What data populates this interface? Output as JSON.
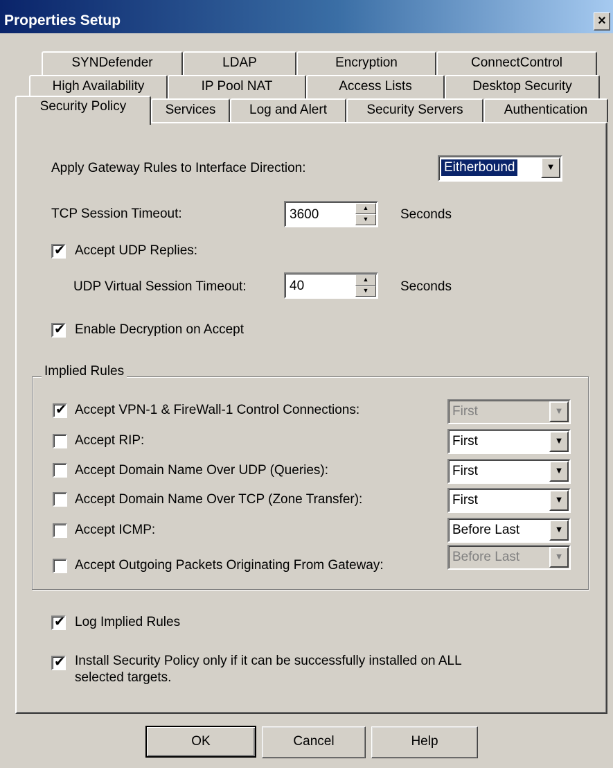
{
  "window": {
    "title": "Properties Setup",
    "close_glyph": "×",
    "close_icon": "close-icon"
  },
  "tabs": {
    "row1": [
      "SYNDefender",
      "LDAP",
      "Encryption",
      "ConnectControl"
    ],
    "row2": [
      "High Availability",
      "IP Pool NAT",
      "Access Lists",
      "Desktop Security"
    ],
    "row3": [
      "Security Policy",
      "Services",
      "Log and Alert",
      "Security Servers",
      "Authentication"
    ],
    "active": "Security Policy"
  },
  "policy": {
    "direction_label": "Apply Gateway Rules to Interface Direction:",
    "direction_value": "Eitherbound",
    "tcp_label": "TCP Session Timeout:",
    "tcp_value": "3600",
    "tcp_unit": "Seconds",
    "udp_replies_label": "Accept UDP Replies:",
    "udp_replies_checked": true,
    "udp_timeout_label": "UDP Virtual Session Timeout:",
    "udp_timeout_value": "40",
    "udp_unit": "Seconds",
    "decryption_label": "Enable Decryption on Accept",
    "decryption_checked": true
  },
  "implied_rules": {
    "group_label": "Implied Rules",
    "rules": [
      {
        "label": "Accept VPN-1 & FireWall-1 Control Connections:",
        "checked": true,
        "value": "First",
        "enabled": false
      },
      {
        "label": "Accept RIP:",
        "checked": false,
        "value": "First",
        "enabled": true
      },
      {
        "label": "Accept Domain Name Over UDP (Queries):",
        "checked": false,
        "value": "First",
        "enabled": true
      },
      {
        "label": "Accept Domain Name Over TCP (Zone Transfer):",
        "checked": false,
        "value": "First",
        "enabled": true
      },
      {
        "label": "Accept ICMP:",
        "checked": false,
        "value": "Before Last",
        "enabled": true
      },
      {
        "label": "Accept Outgoing Packets Originating From Gateway:",
        "checked": false,
        "value": "Before Last",
        "enabled": false
      }
    ]
  },
  "options": {
    "log_implied_label": "Log Implied Rules",
    "log_implied_checked": true,
    "install_label_line1": "Install Security Policy only if it can be successfully installed on ALL",
    "install_label_line2": "selected targets.",
    "install_checked": true
  },
  "buttons": {
    "ok": "OK",
    "cancel": "Cancel",
    "help": "Help"
  },
  "glyphs": {
    "check": "✔",
    "dropdown": "▼",
    "spin_up": "▲",
    "spin_down": "▼"
  }
}
